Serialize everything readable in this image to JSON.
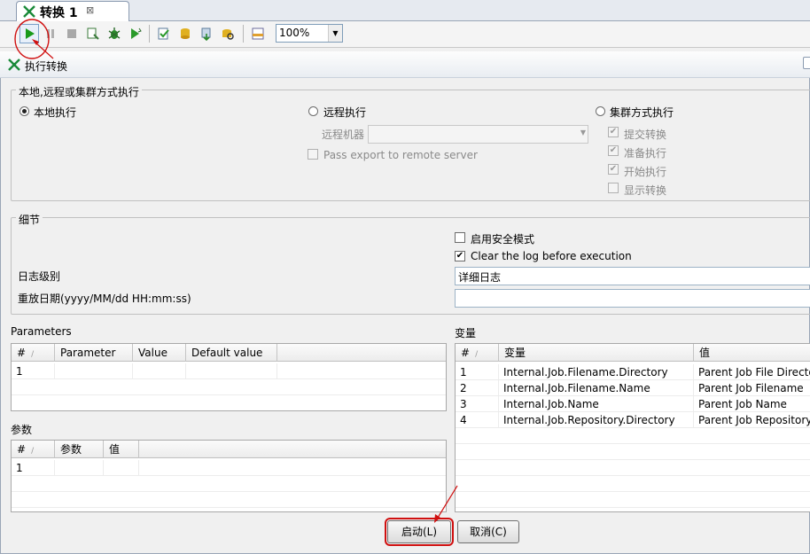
{
  "tab": {
    "title": "转换 1",
    "close": "⊠"
  },
  "toolbar": {
    "zoom_value": "100%"
  },
  "dialog": {
    "title": "执行转换",
    "exec_group": {
      "label": "本地,远程或集群方式执行",
      "local": "本地执行",
      "remote": "远程执行",
      "remote_machine": "远程机器",
      "pass_export": "Pass export to remote server",
      "cluster": "集群方式执行",
      "cluster_options": [
        "提交转换",
        "准备执行",
        "开始执行",
        "显示转换"
      ]
    },
    "details": {
      "label": "细节",
      "safe_mode": "启用安全模式",
      "clear_log": "Clear the log before execution",
      "log_level_label": "日志级别",
      "log_level_value": "详细日志",
      "replay_label": "重放日期(yyyy/MM/dd HH:mm:ss)"
    },
    "parameters": {
      "label": "Parameters",
      "headers": [
        "#",
        "Parameter",
        "Value",
        "Default value"
      ],
      "rows": [
        [
          "1",
          "",
          "",
          ""
        ]
      ]
    },
    "params_cn": {
      "label": "参数",
      "headers": [
        "#",
        "参数",
        "值"
      ],
      "rows": [
        [
          "1",
          "",
          ""
        ]
      ]
    },
    "variables": {
      "label": "变量",
      "headers": [
        "#",
        "变量",
        "值"
      ],
      "rows": [
        [
          "1",
          "Internal.Job.Filename.Directory",
          "Parent Job File Directory"
        ],
        [
          "2",
          "Internal.Job.Filename.Name",
          "Parent Job Filename"
        ],
        [
          "3",
          "Internal.Job.Name",
          "Parent Job Name"
        ],
        [
          "4",
          "Internal.Job.Repository.Directory",
          "Parent Job Repository"
        ]
      ]
    },
    "buttons": {
      "start": "启动(L)",
      "cancel": "取消(C)"
    }
  },
  "colors": {
    "annotation": "#d01010",
    "play_green": "#1a9a1a"
  }
}
